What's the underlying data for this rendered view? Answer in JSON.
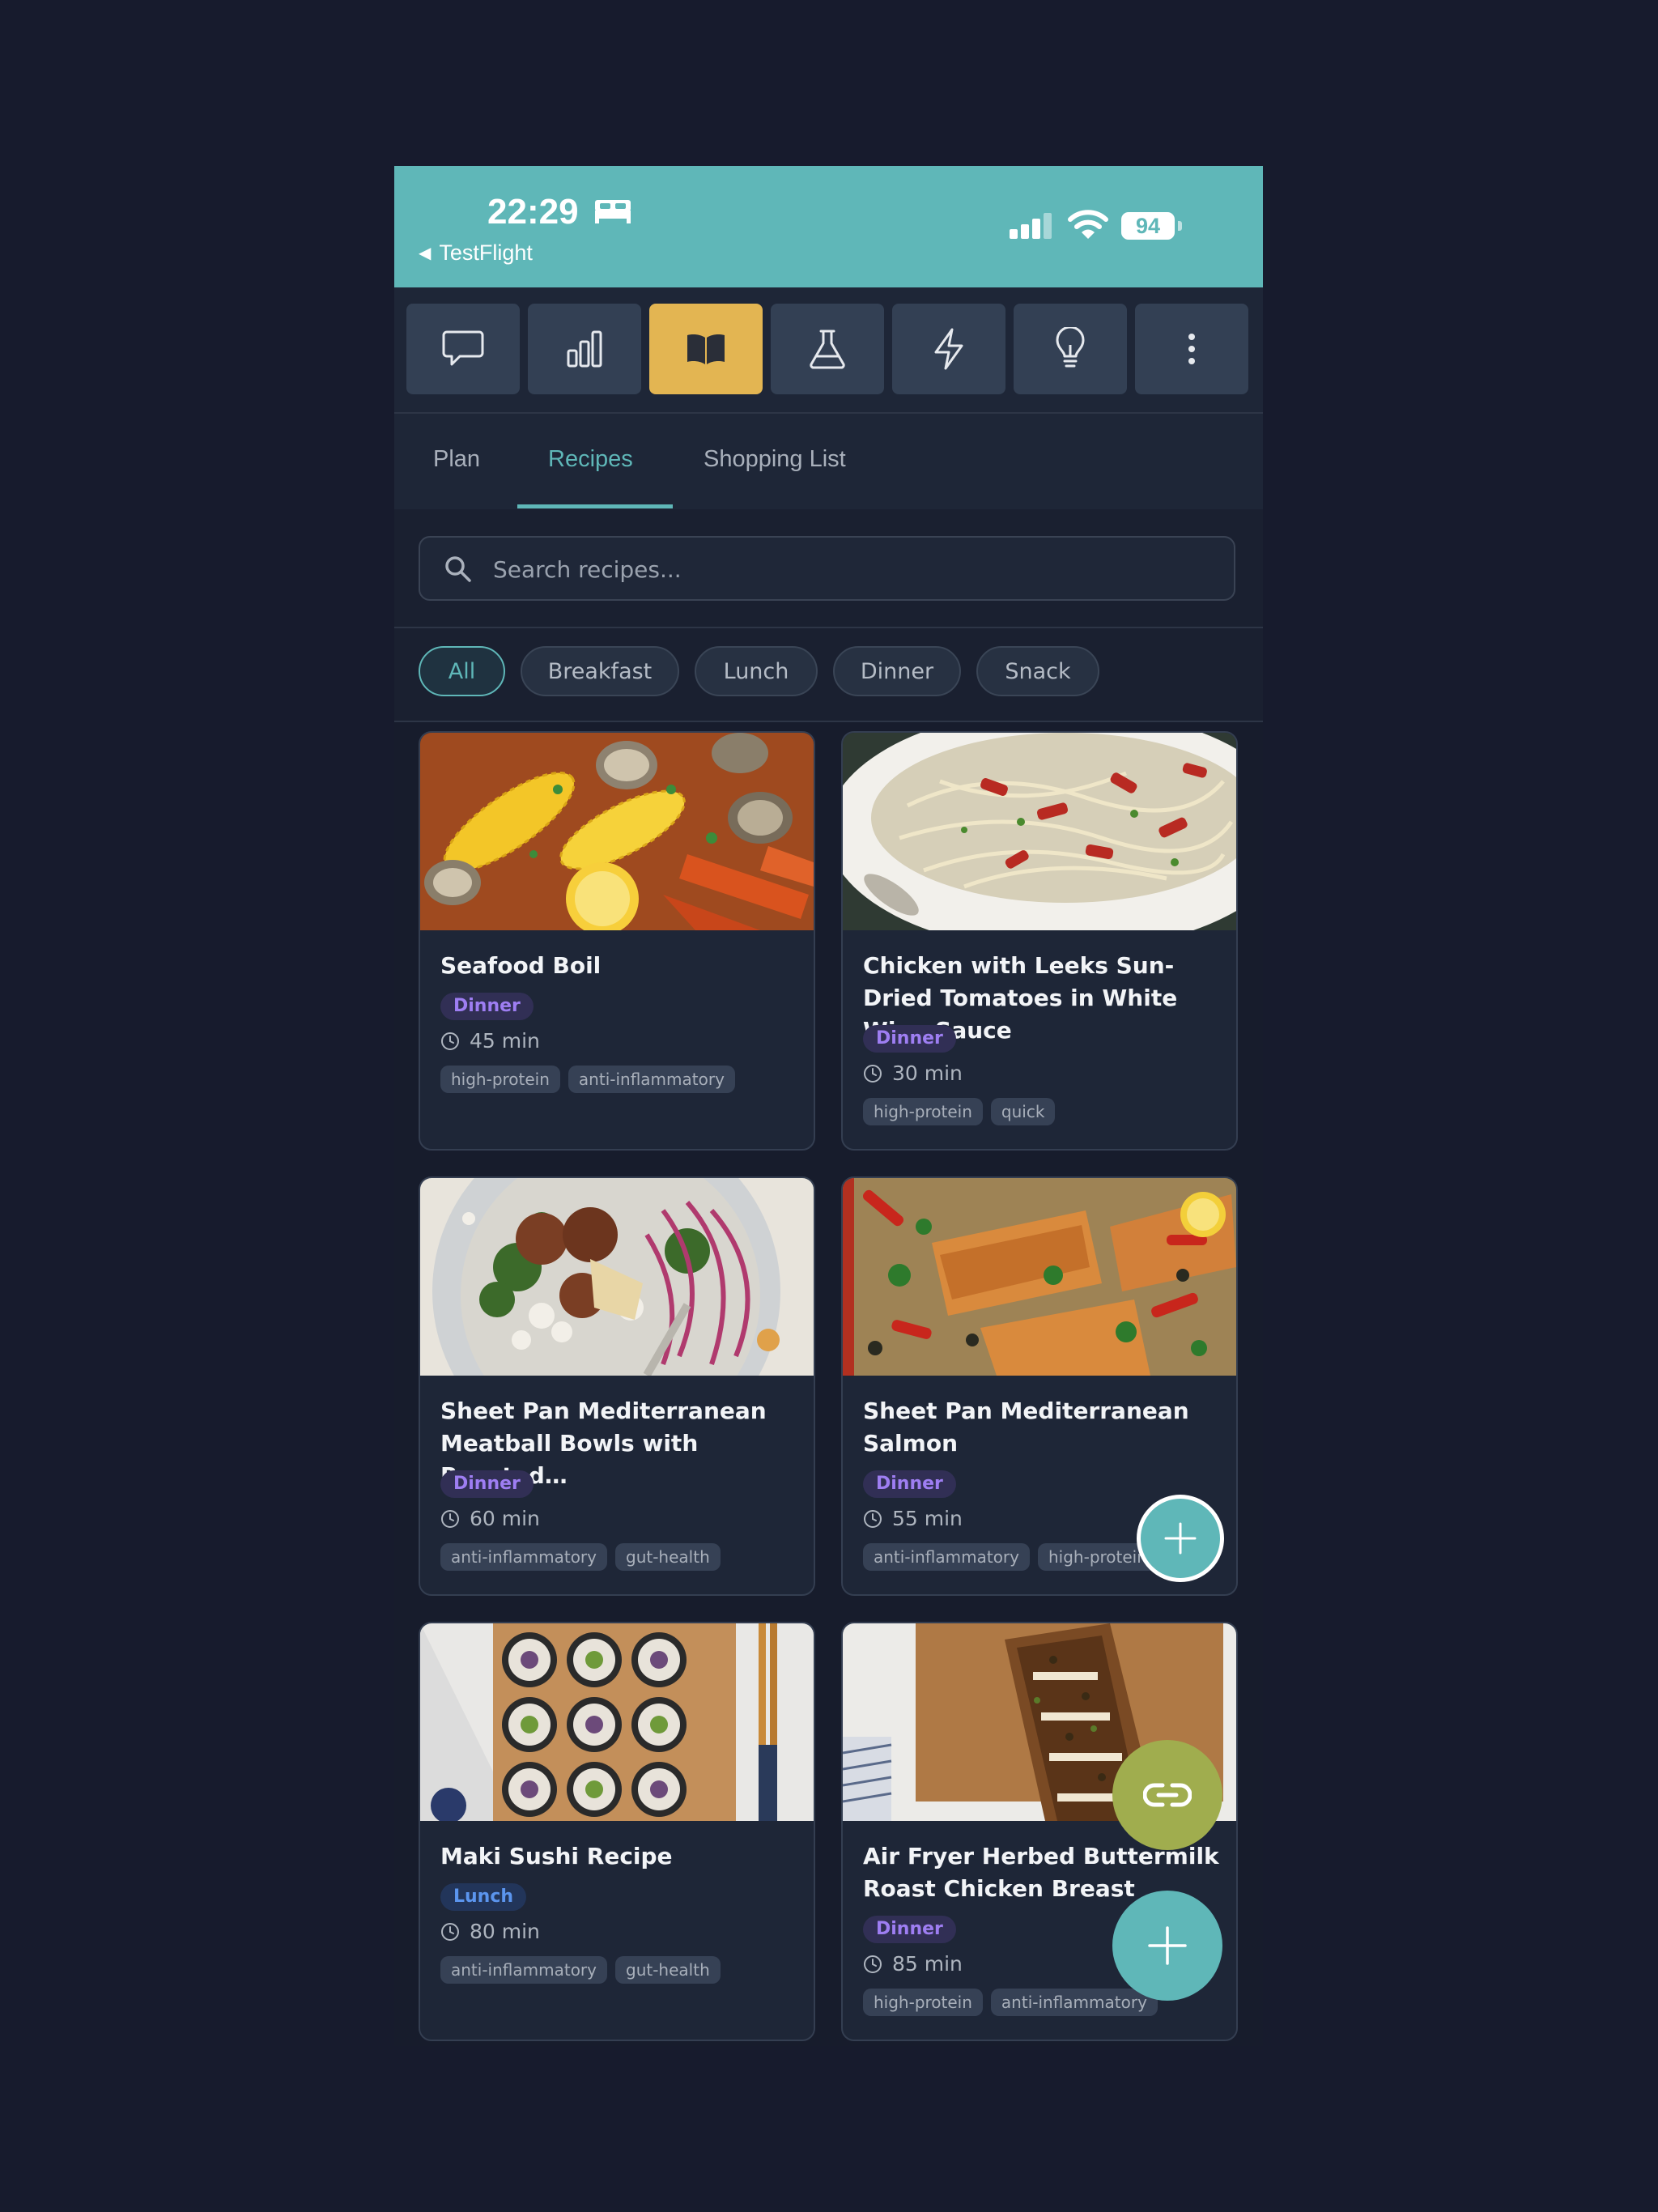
{
  "status_bar": {
    "time": "22:29",
    "back_app": "TestFlight",
    "battery": "94",
    "icons": [
      "bed-icon",
      "signal-icon",
      "wifi-icon",
      "battery-icon"
    ]
  },
  "toolbar": {
    "buttons": [
      {
        "icon": "chat-bubble-icon",
        "active": false
      },
      {
        "icon": "bar-chart-icon",
        "active": false
      },
      {
        "icon": "open-book-icon",
        "active": true
      },
      {
        "icon": "flask-icon",
        "active": false
      },
      {
        "icon": "lightning-icon",
        "active": false
      },
      {
        "icon": "lightbulb-icon",
        "active": false
      },
      {
        "icon": "more-vertical-icon",
        "active": false
      }
    ],
    "active_color": "#e3b552"
  },
  "tabs": {
    "items": [
      "Plan",
      "Recipes",
      "Shopping List"
    ],
    "active": "Recipes"
  },
  "search": {
    "placeholder": "Search recipes...",
    "value": ""
  },
  "filters": {
    "items": [
      "All",
      "Breakfast",
      "Lunch",
      "Dinner",
      "Snack"
    ],
    "active": "All"
  },
  "recipes": [
    {
      "title": "Seafood Boil",
      "meal": "Dinner",
      "time": "45 min",
      "tags": [
        "high-protein",
        "anti-inflammatory"
      ]
    },
    {
      "title": "Chicken with Leeks Sun-Dried Tomatoes in White Wine Sauce",
      "meal": "Dinner",
      "time": "30 min",
      "tags": [
        "high-protein",
        "quick"
      ]
    },
    {
      "title": "Sheet Pan Mediterranean Meatball Bowls with Roasted…",
      "meal": "Dinner",
      "time": "60 min",
      "tags": [
        "anti-inflammatory",
        "gut-health"
      ]
    },
    {
      "title": "Sheet Pan Mediterranean Salmon",
      "meal": "Dinner",
      "time": "55 min",
      "tags": [
        "anti-inflammatory",
        "high-protein"
      ]
    },
    {
      "title": "Maki Sushi Recipe",
      "meal": "Lunch",
      "time": "80 min",
      "tags": [
        "anti-inflammatory",
        "gut-health"
      ]
    },
    {
      "title": "Air Fryer Herbed Buttermilk Roast Chicken Breast",
      "meal": "Dinner",
      "time": "85 min",
      "tags": [
        "high-protein",
        "anti-inflammatory"
      ]
    }
  ],
  "fabs": {
    "add_small_icon": "plus-icon",
    "link_icon": "link-icon",
    "add_icon": "plus-icon"
  },
  "colors": {
    "accent": "#5fb7b8",
    "dinner_badge": "#9e7ef2",
    "lunch_badge": "#5b95ee",
    "link_fab": "#a0ad4e"
  }
}
